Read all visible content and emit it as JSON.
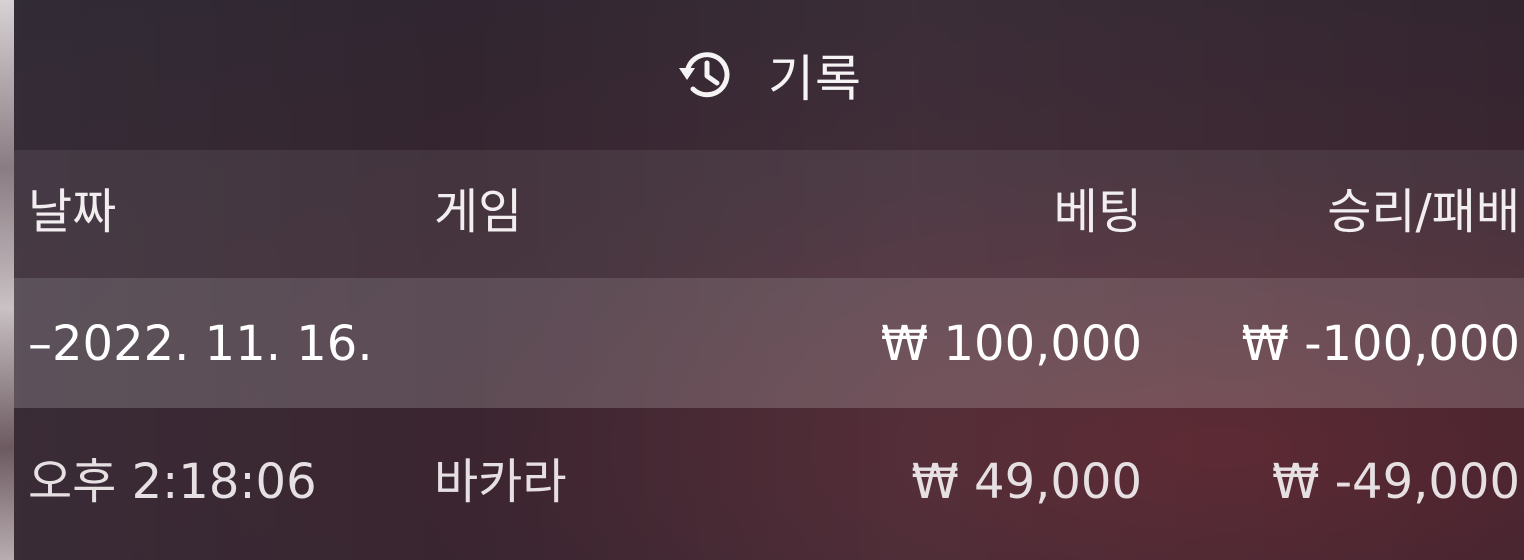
{
  "title": "기록",
  "title_icon": "history-icon",
  "columns": {
    "date": "날짜",
    "game": "게임",
    "bet": "베팅",
    "win_loss": "승리/패배"
  },
  "rows": [
    {
      "date": "–2022. 11. 16.",
      "game": "",
      "bet": "₩ 100,000",
      "win_loss": "₩ -100,000"
    },
    {
      "date": "오후 2:18:06",
      "game": "바카라",
      "bet": "₩ 49,000",
      "win_loss": "₩ -49,000"
    }
  ],
  "colors": {
    "background": "#2b2530",
    "accent_red": "#5a2630",
    "text": "#f4f0f2"
  }
}
